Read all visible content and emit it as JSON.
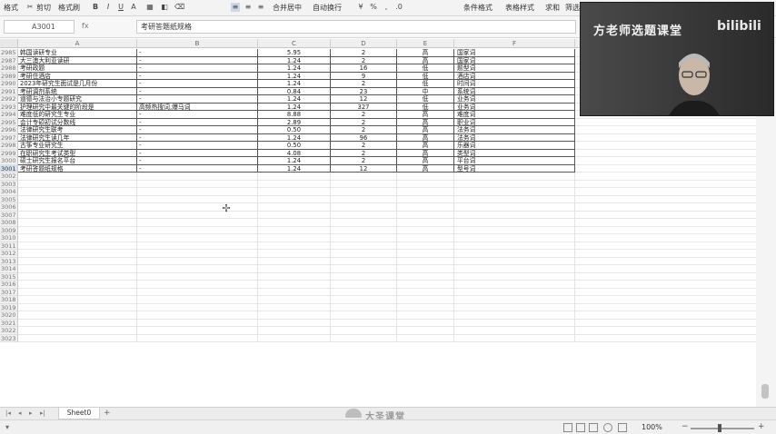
{
  "ribbon": {
    "items": [
      "格式",
      "剪切",
      "粘贴",
      "格式刷",
      "B",
      "I",
      "U",
      "A",
      "合并居中",
      "自动换行",
      "条件格式",
      "表格样式",
      "求和",
      "筛选"
    ]
  },
  "formula_bar": {
    "name_box": "A3001",
    "fx": "fx",
    "content": "考研答题纸规格"
  },
  "columns": [
    "A",
    "B",
    "C",
    "D",
    "E",
    "F"
  ],
  "rows": [
    {
      "num": "2985",
      "a": "韩国读研专业",
      "b": "-",
      "c": "5.95",
      "d": "2",
      "e": "高",
      "f": "国家词"
    },
    {
      "num": "2987",
      "a": "大三澳大利亚读研",
      "b": "-",
      "c": "1.24",
      "d": "2",
      "e": "高",
      "f": "国家词"
    },
    {
      "num": "2988",
      "a": "考研政题",
      "b": "-",
      "c": "1.24",
      "d": "16",
      "e": "低",
      "f": "题型词"
    },
    {
      "num": "2989",
      "a": "考研住酒店",
      "b": "-",
      "c": "1.24",
      "d": "9",
      "e": "低",
      "f": "酒店词"
    },
    {
      "num": "2990",
      "a": "2023年研究生面试是几月份",
      "b": "-",
      "c": "1.24",
      "d": "2",
      "e": "低",
      "f": "时间词"
    },
    {
      "num": "2991",
      "a": "考研调剂系统",
      "b": "-",
      "c": "0.84",
      "d": "23",
      "e": "中",
      "f": "系统词"
    },
    {
      "num": "2992",
      "a": "道德与法治小专题研究",
      "b": "-",
      "c": "1.24",
      "d": "12",
      "e": "低",
      "f": "业务词"
    },
    {
      "num": "2993",
      "a": "护理研究中最关键的阶段是",
      "b": "高频热搜词,爆马词",
      "c": "1.24",
      "d": "327",
      "e": "低",
      "f": "业务词"
    },
    {
      "num": "2994",
      "a": "难度低的研究生专业",
      "b": "-",
      "c": "8.88",
      "d": "2",
      "e": "高",
      "f": "难度词"
    },
    {
      "num": "2995",
      "a": "会计专硕初试分数线",
      "b": "-",
      "c": "2.89",
      "d": "2",
      "e": "高",
      "f": "职业词"
    },
    {
      "num": "2996",
      "a": "法律研究生联考",
      "b": "-",
      "c": "0.50",
      "d": "2",
      "e": "高",
      "f": "法务词"
    },
    {
      "num": "2997",
      "a": "法律研究生读几年",
      "b": "-",
      "c": "1.24",
      "d": "96",
      "e": "高",
      "f": "法务词"
    },
    {
      "num": "2998",
      "a": "古筝专业研究生",
      "b": "-",
      "c": "0.50",
      "d": "2",
      "e": "高",
      "f": "乐器词"
    },
    {
      "num": "2999",
      "a": "在职研究生考试类型",
      "b": "-",
      "c": "4.08",
      "d": "2",
      "e": "高",
      "f": "类型词"
    },
    {
      "num": "3000",
      "a": "硕士研究生报名平台",
      "b": "-",
      "c": "1.24",
      "d": "2",
      "e": "高",
      "f": "平台词"
    },
    {
      "num": "3001",
      "a": "考研答题纸规格",
      "b": "-",
      "c": "1.24",
      "d": "12",
      "e": "高",
      "f": "型号词"
    }
  ],
  "empty_rows": [
    "3002",
    "3003",
    "3004",
    "3005",
    "3006",
    "3007",
    "3008",
    "3009",
    "3010",
    "3011",
    "3012",
    "3013",
    "3014",
    "3015",
    "3016",
    "3017",
    "3018",
    "3019",
    "3020",
    "3021",
    "3022",
    "3023"
  ],
  "sheet_tabs": {
    "active": "Sheet0",
    "add": "+"
  },
  "watermark": "大圣课堂",
  "status_bar": {
    "zoom": "100%",
    "minus": "−",
    "plus": "+"
  },
  "webcam": {
    "title": "方老师选题课堂",
    "logo": "bilibili"
  },
  "colors": {
    "grid_line": "#e2e2e2",
    "data_border": "#555555",
    "header_bg": "#efefef",
    "accent_select": "#cfd8e6"
  }
}
